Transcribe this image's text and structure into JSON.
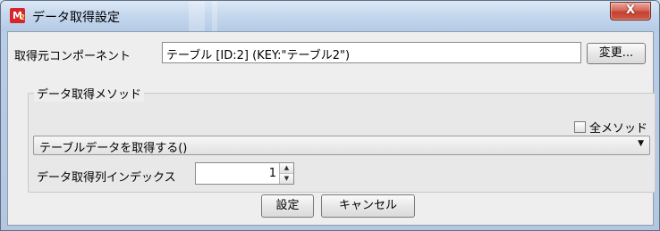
{
  "window": {
    "title": "データ取得設定",
    "icon": "m2-app-icon",
    "icon_letter": "M",
    "icon_sub": "2",
    "close_label": "X"
  },
  "source": {
    "label": "取得元コンポーネント",
    "value": "テーブル [ID:2] (KEY:\"テーブル2\")",
    "change_button": "変更..."
  },
  "method_group": {
    "title": "データ取得メソッド",
    "all_methods_label": "全メソッド",
    "all_methods_checked": false,
    "selected_method": "テーブルデータを取得する()",
    "index_label": "データ取得列インデックス",
    "index_value": "1"
  },
  "footer": {
    "ok_button": "設定",
    "cancel_button": "キャンセル"
  },
  "colors": {
    "titlebar": "#c6d8ee",
    "close_button": "#c4402f",
    "dialog_bg": "#eeeeee",
    "icon_bg": "#d8252b"
  }
}
